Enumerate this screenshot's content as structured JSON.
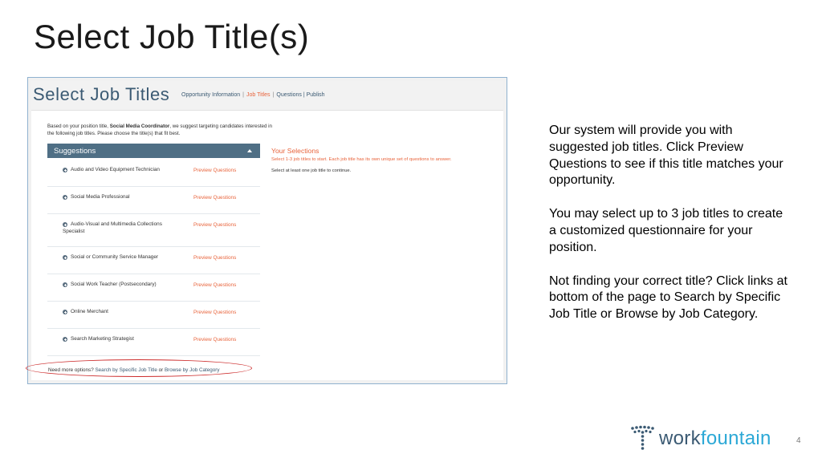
{
  "slide": {
    "title": "Select Job Title(s)",
    "page_number": "4",
    "description": [
      "Our system will provide you with suggested job titles.  Click Preview Questions to see if this title matches your opportunity.",
      "You may select up to 3 job titles to create a customized questionnaire for your position.",
      "Not finding your correct title? Click links at bottom of the page to Search by Specific Job Title or Browse by Job Category."
    ],
    "logo": {
      "work": "work",
      "fountain": "fountain"
    }
  },
  "app": {
    "title": "Select Job Titles",
    "steps": {
      "opportunity": "Opportunity Information",
      "sep": "|",
      "job_titles": "Job Titles",
      "questions_publish": "Questions | Publish"
    },
    "intro": {
      "before": "Based on your position title, ",
      "position": "Social Media Coordinator",
      "after": ", we suggest targeting candidates interested in the following job titles. Please choose the title(s) that fit best."
    },
    "suggestions_label": "Suggestions",
    "preview_label": "Preview Questions",
    "suggestions": [
      "Audio and Video Equipment Technician",
      "Social Media Professional",
      "Audio-Visual and Multimedia Collections Specialist",
      "Social or Community Service Manager",
      "Social Work Teacher (Postsecondary)",
      "Online Merchant",
      "Search Marketing Strategist"
    ],
    "selections": {
      "title": "Your Selections",
      "instruction": "Select 1-3 job titles to start. Each job title has its own unique set of questions to answer.",
      "note": "Select at least one job title to continue."
    },
    "more_options": {
      "prefix": "Need more options? ",
      "search_link": "Search by Specific Job Title",
      "or": " or ",
      "browse_link": "Browse by Job Category"
    }
  },
  "colors": {
    "accent": "#e8643c",
    "brand": "#3b5a73",
    "bar": "#4f6f85",
    "highlight": "#cc2b2b"
  }
}
